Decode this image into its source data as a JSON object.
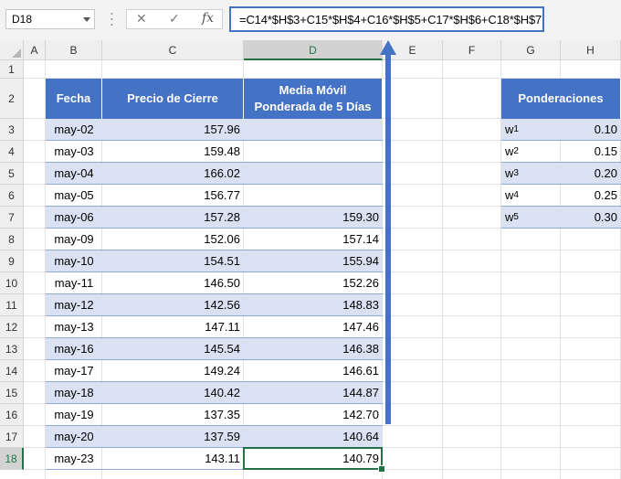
{
  "name_box": "D18",
  "formula_bar": {
    "cancel_icon": "✕",
    "enter_icon": "✓",
    "fx_label": "fx",
    "formula": "=C14*$H$3+C15*$H$4+C16*$H$5+C17*$H$6+C18*$H$7"
  },
  "columns": [
    "A",
    "B",
    "C",
    "D",
    "E",
    "F",
    "G",
    "H"
  ],
  "rows": [
    "1",
    "2",
    "3",
    "4",
    "5",
    "6",
    "7",
    "8",
    "9",
    "10",
    "11",
    "12",
    "13",
    "14",
    "15",
    "16",
    "17",
    "18"
  ],
  "main_table": {
    "headers": [
      "Fecha",
      "Precio de Cierre",
      "Media Móvil",
      "Ponderada de 5 Días"
    ],
    "rows": [
      {
        "fecha": "may-02",
        "precio": "157.96",
        "media": ""
      },
      {
        "fecha": "may-03",
        "precio": "159.48",
        "media": ""
      },
      {
        "fecha": "may-04",
        "precio": "166.02",
        "media": ""
      },
      {
        "fecha": "may-05",
        "precio": "156.77",
        "media": ""
      },
      {
        "fecha": "may-06",
        "precio": "157.28",
        "media": "159.30"
      },
      {
        "fecha": "may-09",
        "precio": "152.06",
        "media": "157.14"
      },
      {
        "fecha": "may-10",
        "precio": "154.51",
        "media": "155.94"
      },
      {
        "fecha": "may-11",
        "precio": "146.50",
        "media": "152.26"
      },
      {
        "fecha": "may-12",
        "precio": "142.56",
        "media": "148.83"
      },
      {
        "fecha": "may-13",
        "precio": "147.11",
        "media": "147.46"
      },
      {
        "fecha": "may-16",
        "precio": "145.54",
        "media": "146.38"
      },
      {
        "fecha": "may-17",
        "precio": "149.24",
        "media": "146.61"
      },
      {
        "fecha": "may-18",
        "precio": "140.42",
        "media": "144.87"
      },
      {
        "fecha": "may-19",
        "precio": "137.35",
        "media": "142.70"
      },
      {
        "fecha": "may-20",
        "precio": "137.59",
        "media": "140.64"
      },
      {
        "fecha": "may-23",
        "precio": "143.11",
        "media": "140.79"
      }
    ]
  },
  "weights_table": {
    "header": "Ponderaciones",
    "rows": [
      {
        "label": "w",
        "sub": "1",
        "value": "0.10"
      },
      {
        "label": "w",
        "sub": "2",
        "value": "0.15"
      },
      {
        "label": "w",
        "sub": "3",
        "value": "0.20"
      },
      {
        "label": "w",
        "sub": "4",
        "value": "0.25"
      },
      {
        "label": "w",
        "sub": "5",
        "value": "0.30"
      }
    ]
  },
  "colors": {
    "table_header": "#4472c4",
    "band": "#d9e1f2",
    "selection": "#217346",
    "arrow": "#4472c4"
  }
}
